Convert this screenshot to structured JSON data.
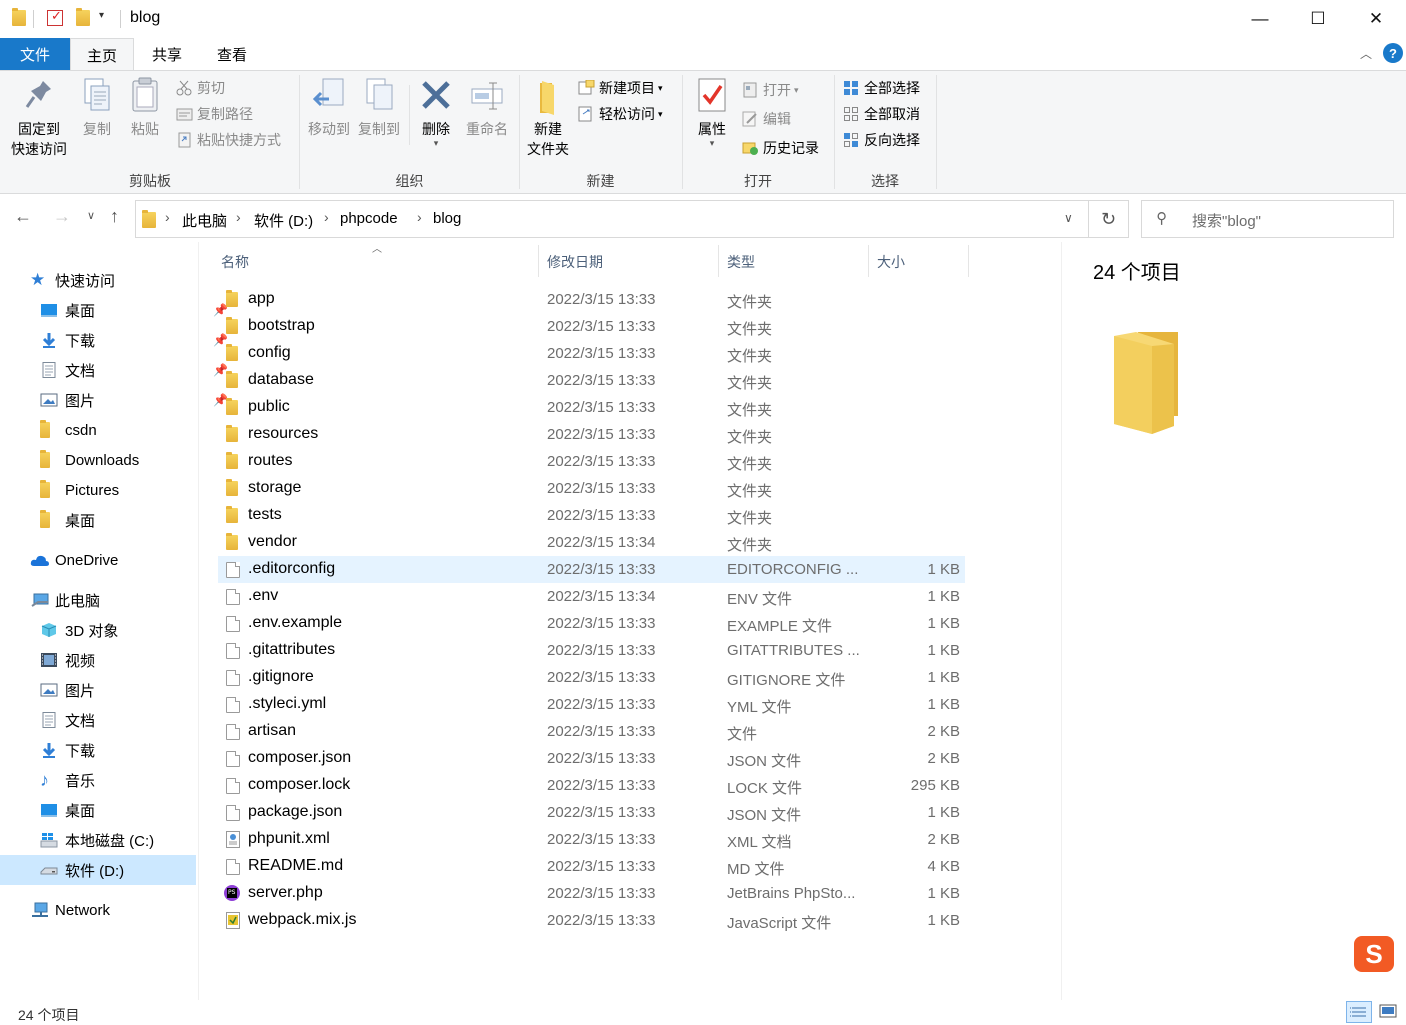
{
  "window": {
    "title": "blog",
    "controls": {
      "minimize": "—",
      "maximize": "☐",
      "close": "✕"
    }
  },
  "tabs": {
    "file": "文件",
    "home": "主页",
    "share": "共享",
    "view": "查看"
  },
  "ribbon": {
    "clipboard": {
      "pin_quick_access": "固定到\n快速访问",
      "copy": "复制",
      "paste": "粘贴",
      "cut": "剪切",
      "copy_path": "复制路径",
      "paste_shortcut": "粘贴快捷方式",
      "label": "剪贴板"
    },
    "organize": {
      "move_to": "移动到",
      "copy_to": "复制到",
      "delete": "删除",
      "rename": "重命名",
      "label": "组织"
    },
    "new": {
      "new_folder": "新建\n文件夹",
      "new_item": "新建项目",
      "easy_access": "轻松访问",
      "label": "新建"
    },
    "open": {
      "properties": "属性",
      "open": "打开",
      "edit": "编辑",
      "history": "历史记录",
      "label": "打开"
    },
    "select": {
      "select_all": "全部选择",
      "select_none": "全部取消",
      "invert": "反向选择",
      "label": "选择"
    }
  },
  "address": {
    "breadcrumbs": [
      "此电脑",
      "软件 (D:)",
      "phpcode",
      "blog"
    ],
    "search_placeholder": "搜索\"blog\""
  },
  "nav": {
    "quick_access": "快速访问",
    "quick_items": [
      "桌面",
      "下载",
      "文档",
      "图片",
      "csdn",
      "Downloads",
      "Pictures",
      "桌面"
    ],
    "onedrive": "OneDrive",
    "this_pc": "此电脑",
    "pc_items": [
      "3D 对象",
      "视频",
      "图片",
      "文档",
      "下载",
      "音乐",
      "桌面",
      "本地磁盘 (C:)",
      "软件 (D:)"
    ],
    "network": "Network"
  },
  "columns": {
    "name": "名称",
    "modified": "修改日期",
    "type": "类型",
    "size": "大小"
  },
  "files": [
    {
      "name": "app",
      "date": "2022/3/15 13:33",
      "type": "文件夹",
      "size": "",
      "kind": "folder"
    },
    {
      "name": "bootstrap",
      "date": "2022/3/15 13:33",
      "type": "文件夹",
      "size": "",
      "kind": "folder"
    },
    {
      "name": "config",
      "date": "2022/3/15 13:33",
      "type": "文件夹",
      "size": "",
      "kind": "folder"
    },
    {
      "name": "database",
      "date": "2022/3/15 13:33",
      "type": "文件夹",
      "size": "",
      "kind": "folder"
    },
    {
      "name": "public",
      "date": "2022/3/15 13:33",
      "type": "文件夹",
      "size": "",
      "kind": "folder"
    },
    {
      "name": "resources",
      "date": "2022/3/15 13:33",
      "type": "文件夹",
      "size": "",
      "kind": "folder"
    },
    {
      "name": "routes",
      "date": "2022/3/15 13:33",
      "type": "文件夹",
      "size": "",
      "kind": "folder"
    },
    {
      "name": "storage",
      "date": "2022/3/15 13:33",
      "type": "文件夹",
      "size": "",
      "kind": "folder"
    },
    {
      "name": "tests",
      "date": "2022/3/15 13:33",
      "type": "文件夹",
      "size": "",
      "kind": "folder"
    },
    {
      "name": "vendor",
      "date": "2022/3/15 13:34",
      "type": "文件夹",
      "size": "",
      "kind": "folder"
    },
    {
      "name": ".editorconfig",
      "date": "2022/3/15 13:33",
      "type": "EDITORCONFIG ...",
      "size": "1 KB",
      "kind": "file"
    },
    {
      "name": ".env",
      "date": "2022/3/15 13:34",
      "type": "ENV 文件",
      "size": "1 KB",
      "kind": "file"
    },
    {
      "name": ".env.example",
      "date": "2022/3/15 13:33",
      "type": "EXAMPLE 文件",
      "size": "1 KB",
      "kind": "file"
    },
    {
      "name": ".gitattributes",
      "date": "2022/3/15 13:33",
      "type": "GITATTRIBUTES ...",
      "size": "1 KB",
      "kind": "file"
    },
    {
      "name": ".gitignore",
      "date": "2022/3/15 13:33",
      "type": "GITIGNORE 文件",
      "size": "1 KB",
      "kind": "file"
    },
    {
      "name": ".styleci.yml",
      "date": "2022/3/15 13:33",
      "type": "YML 文件",
      "size": "1 KB",
      "kind": "file"
    },
    {
      "name": "artisan",
      "date": "2022/3/15 13:33",
      "type": "文件",
      "size": "2 KB",
      "kind": "file"
    },
    {
      "name": "composer.json",
      "date": "2022/3/15 13:33",
      "type": "JSON 文件",
      "size": "2 KB",
      "kind": "file"
    },
    {
      "name": "composer.lock",
      "date": "2022/3/15 13:33",
      "type": "LOCK 文件",
      "size": "295 KB",
      "kind": "file"
    },
    {
      "name": "package.json",
      "date": "2022/3/15 13:33",
      "type": "JSON 文件",
      "size": "1 KB",
      "kind": "file"
    },
    {
      "name": "phpunit.xml",
      "date": "2022/3/15 13:33",
      "type": "XML 文档",
      "size": "2 KB",
      "kind": "xml"
    },
    {
      "name": "README.md",
      "date": "2022/3/15 13:33",
      "type": "MD 文件",
      "size": "4 KB",
      "kind": "file"
    },
    {
      "name": "server.php",
      "date": "2022/3/15 13:33",
      "type": "JetBrains PhpSto...",
      "size": "1 KB",
      "kind": "php"
    },
    {
      "name": "webpack.mix.js",
      "date": "2022/3/15 13:33",
      "type": "JavaScript 文件",
      "size": "1 KB",
      "kind": "js"
    }
  ],
  "preview": {
    "count": "24 个项目"
  },
  "status": {
    "count": "24 个项目"
  }
}
